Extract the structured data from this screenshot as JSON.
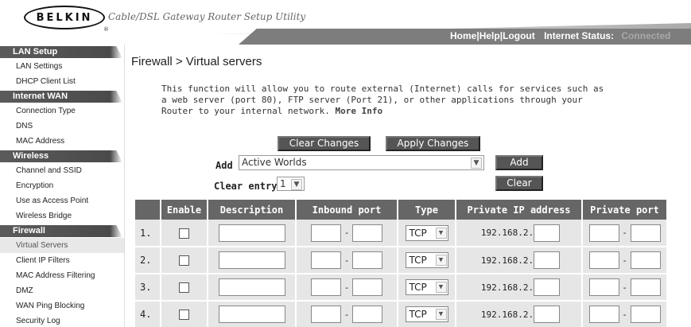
{
  "header": {
    "logo": "BELKIN",
    "logo_mark": "®",
    "app_title": "Cable/DSL Gateway Router Setup Utility",
    "links": [
      "Home",
      "Help",
      "Logout"
    ],
    "status_label": "Internet Status:",
    "status_value": "Connected"
  },
  "sidebar": {
    "sections": [
      {
        "title": "LAN Setup",
        "items": [
          "LAN Settings",
          "DHCP Client List"
        ]
      },
      {
        "title": "Internet WAN",
        "items": [
          "Connection Type",
          "DNS",
          "MAC Address"
        ]
      },
      {
        "title": "Wireless",
        "items": [
          "Channel and SSID",
          "Encryption",
          "Use as Access Point",
          "Wireless Bridge"
        ]
      },
      {
        "title": "Firewall",
        "items": [
          "Virtual Servers",
          "Client IP Filters",
          "MAC Address Filtering",
          "DMZ",
          "WAN Ping Blocking",
          "Security Log"
        ]
      }
    ],
    "active_item": "Virtual Servers"
  },
  "main": {
    "title": "Firewall > Virtual servers",
    "description": "This function will allow you to route external (Internet) calls for services such as a web server (port 80), FTP server (Port 21), or other applications through your Router to your internal network.",
    "more_info": "More Info",
    "buttons": {
      "clear_changes": "Clear Changes",
      "apply_changes": "Apply Changes",
      "add": "Add",
      "clear": "Clear"
    },
    "add_label": "Add",
    "add_select_value": "Active Worlds",
    "clear_entry_label": "Clear entry",
    "clear_entry_value": "1",
    "table": {
      "headers": [
        "",
        "Enable",
        "Description",
        "Inbound port",
        "Type",
        "Private IP address",
        "Private port"
      ],
      "rows": [
        {
          "num": "1.",
          "type": "TCP",
          "ip_prefix": "192.168.2."
        },
        {
          "num": "2.",
          "type": "TCP",
          "ip_prefix": "192.168.2."
        },
        {
          "num": "3.",
          "type": "TCP",
          "ip_prefix": "192.168.2."
        },
        {
          "num": "4.",
          "type": "TCP",
          "ip_prefix": "192.168.2."
        }
      ]
    }
  }
}
